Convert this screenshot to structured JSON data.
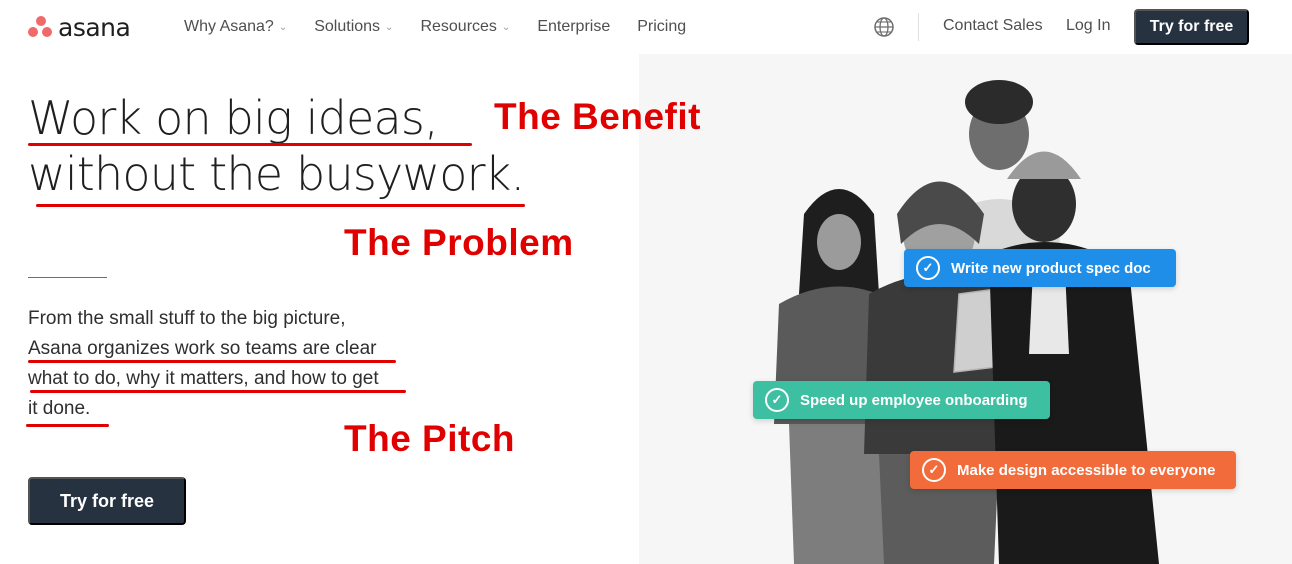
{
  "nav": {
    "logo_text": "asana",
    "items": [
      {
        "label": "Why Asana?",
        "has_dropdown": true
      },
      {
        "label": "Solutions",
        "has_dropdown": true
      },
      {
        "label": "Resources",
        "has_dropdown": true
      },
      {
        "label": "Enterprise",
        "has_dropdown": false
      },
      {
        "label": "Pricing",
        "has_dropdown": false
      }
    ],
    "language_icon": "globe-icon",
    "contact_sales": "Contact Sales",
    "login": "Log In",
    "cta": "Try for free"
  },
  "hero": {
    "headline_line1": "Work on big ideas,",
    "headline_line2": "without the busywork.",
    "body_line1": "From the small stuff to the big picture,",
    "body_line2": "Asana organizes work so teams are clear",
    "body_line3": "what to do, why it matters, and how to get",
    "body_line4": "it done.",
    "cta": "Try for free"
  },
  "annotations": {
    "benefit": "The Benefit",
    "problem": "The Problem",
    "pitch": "The Pitch"
  },
  "tasks": [
    {
      "label": "Write new product spec doc",
      "color": "#1f8ee8",
      "icon": "check-circle-icon"
    },
    {
      "label": "Speed up employee onboarding",
      "color": "#3dbfa1",
      "icon": "check-circle-icon"
    },
    {
      "label": "Make design accessible to everyone",
      "color": "#f26b3a",
      "icon": "check-circle-icon"
    }
  ],
  "colors": {
    "brand": "#f06a6a",
    "cta_bg": "#273240",
    "annotation": "#e00000"
  }
}
